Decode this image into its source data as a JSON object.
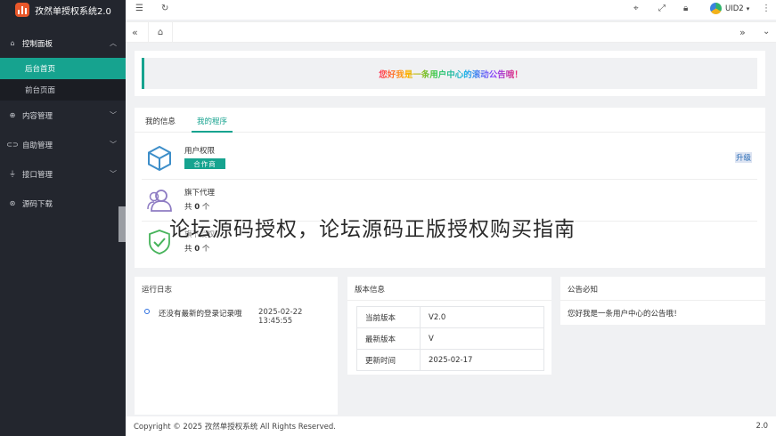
{
  "app": {
    "title": "孜然单授权系统2.0"
  },
  "sidebar": {
    "items": [
      {
        "label": "控制面板",
        "icon": "home-icon",
        "expanded": true,
        "children": [
          {
            "label": "后台首页",
            "active": true
          },
          {
            "label": "前台页面",
            "active": false
          }
        ]
      },
      {
        "label": "内容管理",
        "icon": "globe-icon"
      },
      {
        "label": "自助管理",
        "icon": "link-icon"
      },
      {
        "label": "接口管理",
        "icon": "plug-icon"
      },
      {
        "label": "源码下载",
        "icon": "download-icon"
      }
    ]
  },
  "topbar": {
    "user": "UID2"
  },
  "notice": {
    "text": "您好我是一条用户中心的滚动公告哦！"
  },
  "program": {
    "tabs": [
      {
        "label": "我的信息",
        "active": false
      },
      {
        "label": "我的程序",
        "active": true
      }
    ],
    "rows": [
      {
        "title": "用户权限",
        "badge": "合作商",
        "action": "升级",
        "icon": "cube-icon"
      },
      {
        "title": "旗下代理",
        "count_prefix": "共",
        "count": "0",
        "count_suffix": "个",
        "icon": "users-icon"
      },
      {
        "title": "旗下授权",
        "count_prefix": "共",
        "count": "0",
        "count_suffix": "个",
        "icon": "shield-check-icon"
      }
    ]
  },
  "log": {
    "title": "运行日志",
    "entries": [
      {
        "text": "还没有最新的登录记录哦",
        "time": "2025-02-22 13:45:55"
      }
    ]
  },
  "version": {
    "title": "版本信息",
    "rows": [
      {
        "label": "当前版本",
        "value": "V2.0"
      },
      {
        "label": "最新版本",
        "value": "V"
      },
      {
        "label": "更新时间",
        "value": "2025-02-17"
      }
    ]
  },
  "announcement": {
    "title": "公告必知",
    "text": "您好我是一条用户中心的公告哦！"
  },
  "footer": {
    "copyright": "Copyright © 2025 孜然单授权系统 All Rights Reserved.",
    "version": "2.0"
  },
  "watermark": {
    "text": "论坛源码授权，论坛源码正版授权购买指南"
  },
  "colors": {
    "accent": "#16a38f",
    "sidebar_bg": "#23262e",
    "logo": "#e8572a"
  }
}
